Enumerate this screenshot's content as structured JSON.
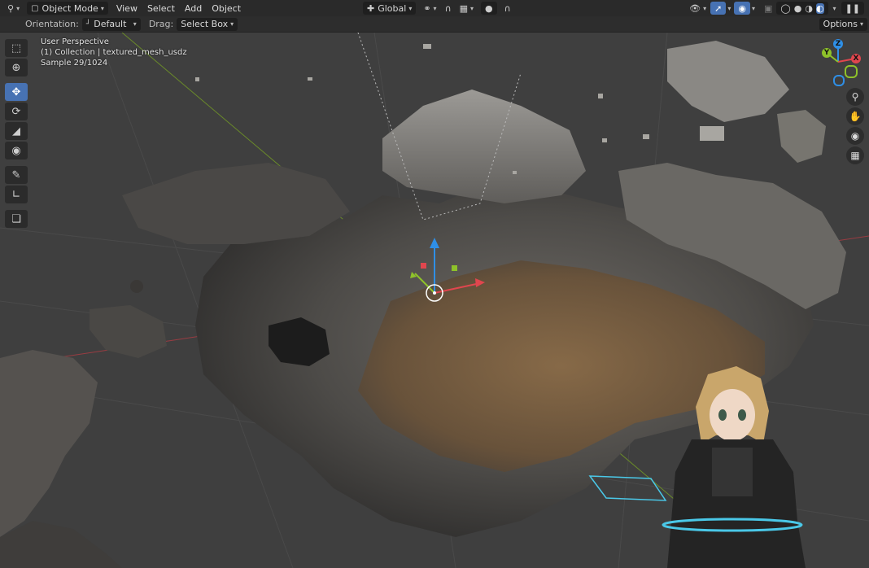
{
  "header": {
    "editor_icon": "3d-viewport-icon",
    "mode_label": "Object Mode",
    "menus": [
      "View",
      "Select",
      "Add",
      "Object"
    ],
    "transform_orientation": "Global",
    "options_label": "Options"
  },
  "tool_header": {
    "orientation_label": "Orientation:",
    "orientation_value": "Default",
    "drag_label": "Drag:",
    "drag_value": "Select Box"
  },
  "viewport": {
    "perspective_text": "User Perspective",
    "collection_text": "(1) Collection | textured_mesh_usdz",
    "sample_text": "Sample 29/1024"
  },
  "toolbar": {
    "tools": [
      "select-box-icon",
      "cursor-icon",
      "move-icon",
      "rotate-icon",
      "scale-icon",
      "transform-icon",
      "annotate-icon",
      "measure-icon",
      "add-cube-icon"
    ],
    "active_tool": "move-icon"
  },
  "navigation": {
    "axes": [
      "X",
      "Y",
      "Z"
    ],
    "buttons": [
      "zoom-icon",
      "hand-pan-icon",
      "camera-icon",
      "grid-view-icon"
    ]
  },
  "colors": {
    "active": "#4772b3",
    "axis_x": "#e0464e",
    "axis_y": "#8ec22a",
    "axis_z": "#2f8fe6",
    "header_bg": "#2a2a2a"
  }
}
